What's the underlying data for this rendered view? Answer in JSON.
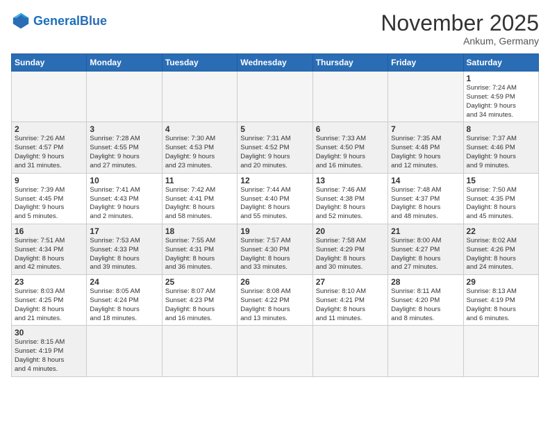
{
  "header": {
    "logo_general": "General",
    "logo_blue": "Blue",
    "month_title": "November 2025",
    "location": "Ankum, Germany"
  },
  "days_of_week": [
    "Sunday",
    "Monday",
    "Tuesday",
    "Wednesday",
    "Thursday",
    "Friday",
    "Saturday"
  ],
  "weeks": [
    [
      {
        "day": "",
        "info": ""
      },
      {
        "day": "",
        "info": ""
      },
      {
        "day": "",
        "info": ""
      },
      {
        "day": "",
        "info": ""
      },
      {
        "day": "",
        "info": ""
      },
      {
        "day": "",
        "info": ""
      },
      {
        "day": "1",
        "info": "Sunrise: 7:24 AM\nSunset: 4:59 PM\nDaylight: 9 hours\nand 34 minutes."
      }
    ],
    [
      {
        "day": "2",
        "info": "Sunrise: 7:26 AM\nSunset: 4:57 PM\nDaylight: 9 hours\nand 31 minutes."
      },
      {
        "day": "3",
        "info": "Sunrise: 7:28 AM\nSunset: 4:55 PM\nDaylight: 9 hours\nand 27 minutes."
      },
      {
        "day": "4",
        "info": "Sunrise: 7:30 AM\nSunset: 4:53 PM\nDaylight: 9 hours\nand 23 minutes."
      },
      {
        "day": "5",
        "info": "Sunrise: 7:31 AM\nSunset: 4:52 PM\nDaylight: 9 hours\nand 20 minutes."
      },
      {
        "day": "6",
        "info": "Sunrise: 7:33 AM\nSunset: 4:50 PM\nDaylight: 9 hours\nand 16 minutes."
      },
      {
        "day": "7",
        "info": "Sunrise: 7:35 AM\nSunset: 4:48 PM\nDaylight: 9 hours\nand 12 minutes."
      },
      {
        "day": "8",
        "info": "Sunrise: 7:37 AM\nSunset: 4:46 PM\nDaylight: 9 hours\nand 9 minutes."
      }
    ],
    [
      {
        "day": "9",
        "info": "Sunrise: 7:39 AM\nSunset: 4:45 PM\nDaylight: 9 hours\nand 5 minutes."
      },
      {
        "day": "10",
        "info": "Sunrise: 7:41 AM\nSunset: 4:43 PM\nDaylight: 9 hours\nand 2 minutes."
      },
      {
        "day": "11",
        "info": "Sunrise: 7:42 AM\nSunset: 4:41 PM\nDaylight: 8 hours\nand 58 minutes."
      },
      {
        "day": "12",
        "info": "Sunrise: 7:44 AM\nSunset: 4:40 PM\nDaylight: 8 hours\nand 55 minutes."
      },
      {
        "day": "13",
        "info": "Sunrise: 7:46 AM\nSunset: 4:38 PM\nDaylight: 8 hours\nand 52 minutes."
      },
      {
        "day": "14",
        "info": "Sunrise: 7:48 AM\nSunset: 4:37 PM\nDaylight: 8 hours\nand 48 minutes."
      },
      {
        "day": "15",
        "info": "Sunrise: 7:50 AM\nSunset: 4:35 PM\nDaylight: 8 hours\nand 45 minutes."
      }
    ],
    [
      {
        "day": "16",
        "info": "Sunrise: 7:51 AM\nSunset: 4:34 PM\nDaylight: 8 hours\nand 42 minutes."
      },
      {
        "day": "17",
        "info": "Sunrise: 7:53 AM\nSunset: 4:33 PM\nDaylight: 8 hours\nand 39 minutes."
      },
      {
        "day": "18",
        "info": "Sunrise: 7:55 AM\nSunset: 4:31 PM\nDaylight: 8 hours\nand 36 minutes."
      },
      {
        "day": "19",
        "info": "Sunrise: 7:57 AM\nSunset: 4:30 PM\nDaylight: 8 hours\nand 33 minutes."
      },
      {
        "day": "20",
        "info": "Sunrise: 7:58 AM\nSunset: 4:29 PM\nDaylight: 8 hours\nand 30 minutes."
      },
      {
        "day": "21",
        "info": "Sunrise: 8:00 AM\nSunset: 4:27 PM\nDaylight: 8 hours\nand 27 minutes."
      },
      {
        "day": "22",
        "info": "Sunrise: 8:02 AM\nSunset: 4:26 PM\nDaylight: 8 hours\nand 24 minutes."
      }
    ],
    [
      {
        "day": "23",
        "info": "Sunrise: 8:03 AM\nSunset: 4:25 PM\nDaylight: 8 hours\nand 21 minutes."
      },
      {
        "day": "24",
        "info": "Sunrise: 8:05 AM\nSunset: 4:24 PM\nDaylight: 8 hours\nand 18 minutes."
      },
      {
        "day": "25",
        "info": "Sunrise: 8:07 AM\nSunset: 4:23 PM\nDaylight: 8 hours\nand 16 minutes."
      },
      {
        "day": "26",
        "info": "Sunrise: 8:08 AM\nSunset: 4:22 PM\nDaylight: 8 hours\nand 13 minutes."
      },
      {
        "day": "27",
        "info": "Sunrise: 8:10 AM\nSunset: 4:21 PM\nDaylight: 8 hours\nand 11 minutes."
      },
      {
        "day": "28",
        "info": "Sunrise: 8:11 AM\nSunset: 4:20 PM\nDaylight: 8 hours\nand 8 minutes."
      },
      {
        "day": "29",
        "info": "Sunrise: 8:13 AM\nSunset: 4:19 PM\nDaylight: 8 hours\nand 6 minutes."
      }
    ],
    [
      {
        "day": "30",
        "info": "Sunrise: 8:15 AM\nSunset: 4:19 PM\nDaylight: 8 hours\nand 4 minutes."
      },
      {
        "day": "",
        "info": ""
      },
      {
        "day": "",
        "info": ""
      },
      {
        "day": "",
        "info": ""
      },
      {
        "day": "",
        "info": ""
      },
      {
        "day": "",
        "info": ""
      },
      {
        "day": "",
        "info": ""
      }
    ]
  ]
}
